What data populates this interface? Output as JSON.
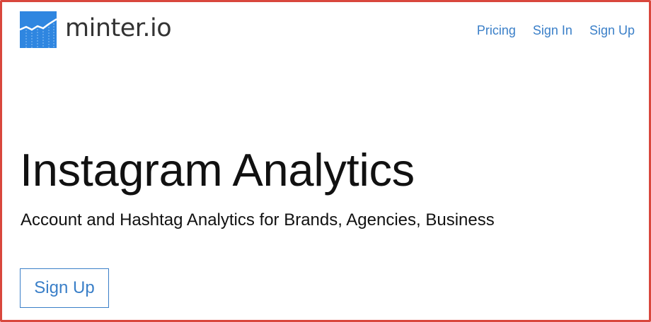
{
  "brand": {
    "name": "minter.io",
    "logo_icon": "line-chart-logo-icon",
    "logo_color": "#2f86e0"
  },
  "nav": {
    "items": [
      {
        "label": "Pricing"
      },
      {
        "label": "Sign In"
      },
      {
        "label": "Sign Up"
      }
    ]
  },
  "hero": {
    "title": "Instagram Analytics",
    "subtitle": "Account and Hashtag Analytics for Brands, Agencies, Business",
    "cta_label": "Sign Up"
  },
  "colors": {
    "link": "#3a7fc8",
    "frame_border": "#d9473d",
    "text": "#111111"
  }
}
